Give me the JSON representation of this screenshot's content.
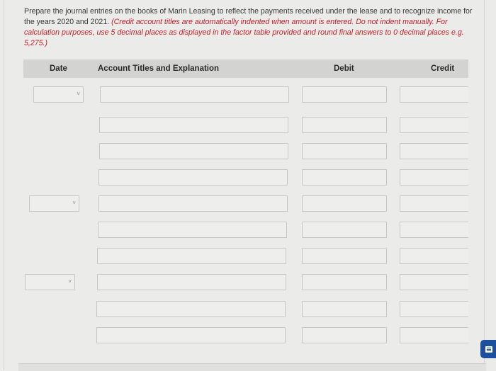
{
  "instructions": {
    "text": "Prepare the journal entries on the books of Marin Leasing to reflect the payments received under the lease and to recognize income for the years 2020 and 2021.",
    "note": "(Credit account titles are automatically indented when amount is entered. Do not indent manually. For calculation purposes, use 5 decimal places as displayed in the factor table provided and round final answers to 0 decimal places e.g. 5,275.)"
  },
  "table": {
    "headers": {
      "date": "Date",
      "account": "Account Titles and Explanation",
      "debit": "Debit",
      "credit": "Credit"
    },
    "rows": [
      {
        "has_date": true,
        "date": "",
        "account": "",
        "debit": "",
        "credit": ""
      },
      {
        "has_date": false,
        "account": "",
        "debit": "",
        "credit": ""
      },
      {
        "has_date": false,
        "account": "",
        "debit": "",
        "credit": ""
      },
      {
        "has_date": false,
        "account": "",
        "debit": "",
        "credit": ""
      },
      {
        "has_date": true,
        "date": "",
        "account": "",
        "debit": "",
        "credit": ""
      },
      {
        "has_date": false,
        "account": "",
        "debit": "",
        "credit": ""
      },
      {
        "has_date": false,
        "account": "",
        "debit": "",
        "credit": ""
      },
      {
        "has_date": true,
        "date": "",
        "account": "",
        "debit": "",
        "credit": ""
      },
      {
        "has_date": false,
        "account": "",
        "debit": "",
        "credit": ""
      },
      {
        "has_date": false,
        "account": "",
        "debit": "",
        "credit": ""
      }
    ]
  },
  "icons": {
    "chevron": "chevron-down-icon",
    "chat": "chat-icon"
  },
  "colors": {
    "note_red": "#c8202a",
    "header_gray": "#d3d3d1",
    "chat_blue": "#1c4f9c"
  }
}
